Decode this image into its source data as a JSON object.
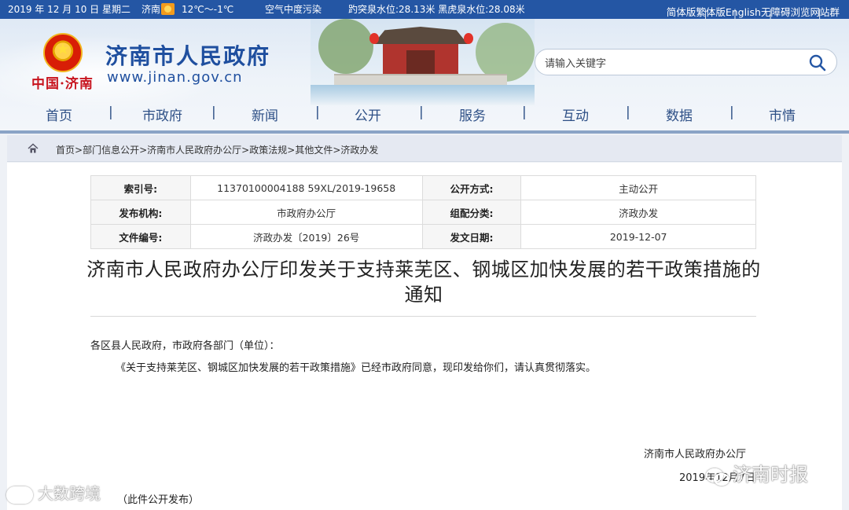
{
  "topbar": {
    "date": "2019 年 12 月 10 日 星期二",
    "city": "济南",
    "weather_icon": "sun-icon",
    "temperature": "12℃～-1℃",
    "air": "空气中度污染",
    "water": "趵突泉水位:28.13米 黑虎泉水位:28.08米",
    "links": [
      "简体版",
      "繁体版",
      "English",
      "无障碍浏览",
      "网站群"
    ]
  },
  "header": {
    "title": "济南市人民政府",
    "url": "www.jinan.gov.cn",
    "seal_text": "中国·济南"
  },
  "search": {
    "placeholder": "请输入关键字"
  },
  "nav": [
    "首页",
    "市政府",
    "新闻",
    "公开",
    "服务",
    "互动",
    "数据",
    "市情"
  ],
  "breadcrumb": [
    "首页",
    "部门信息公开",
    "济南市人民政府办公厅",
    "政策法规",
    "其他文件",
    "济政办发"
  ],
  "meta": {
    "index_label": "索引号:",
    "index_value": "11370100004188 59XL/2019-19658",
    "open_label": "公开方式:",
    "open_value": "主动公开",
    "org_label": "发布机构:",
    "org_value": "市政府办公厅",
    "cat_label": "组配分类:",
    "cat_value": "济政办发",
    "doc_label": "文件编号:",
    "doc_value": "济政办发〔2019〕26号",
    "date_label": "发文日期:",
    "date_value": "2019-12-07"
  },
  "document": {
    "title": "济南市人民政府办公厅印发关于支持莱芜区、钢城区加快发展的若干政策措施的通知",
    "greeting": "各区县人民政府，市政府各部门（单位）：",
    "body": "《关于支持莱芜区、钢城区加快发展的若干政策措施》已经市政府同意，现印发给你们，请认真贯彻落实。",
    "signature": "济南市人民政府办公厅",
    "date": "2019年12月7日",
    "publish_note": "（此件公开发布）"
  },
  "watermarks": {
    "left": "大数跨境",
    "right": "济南时报"
  }
}
